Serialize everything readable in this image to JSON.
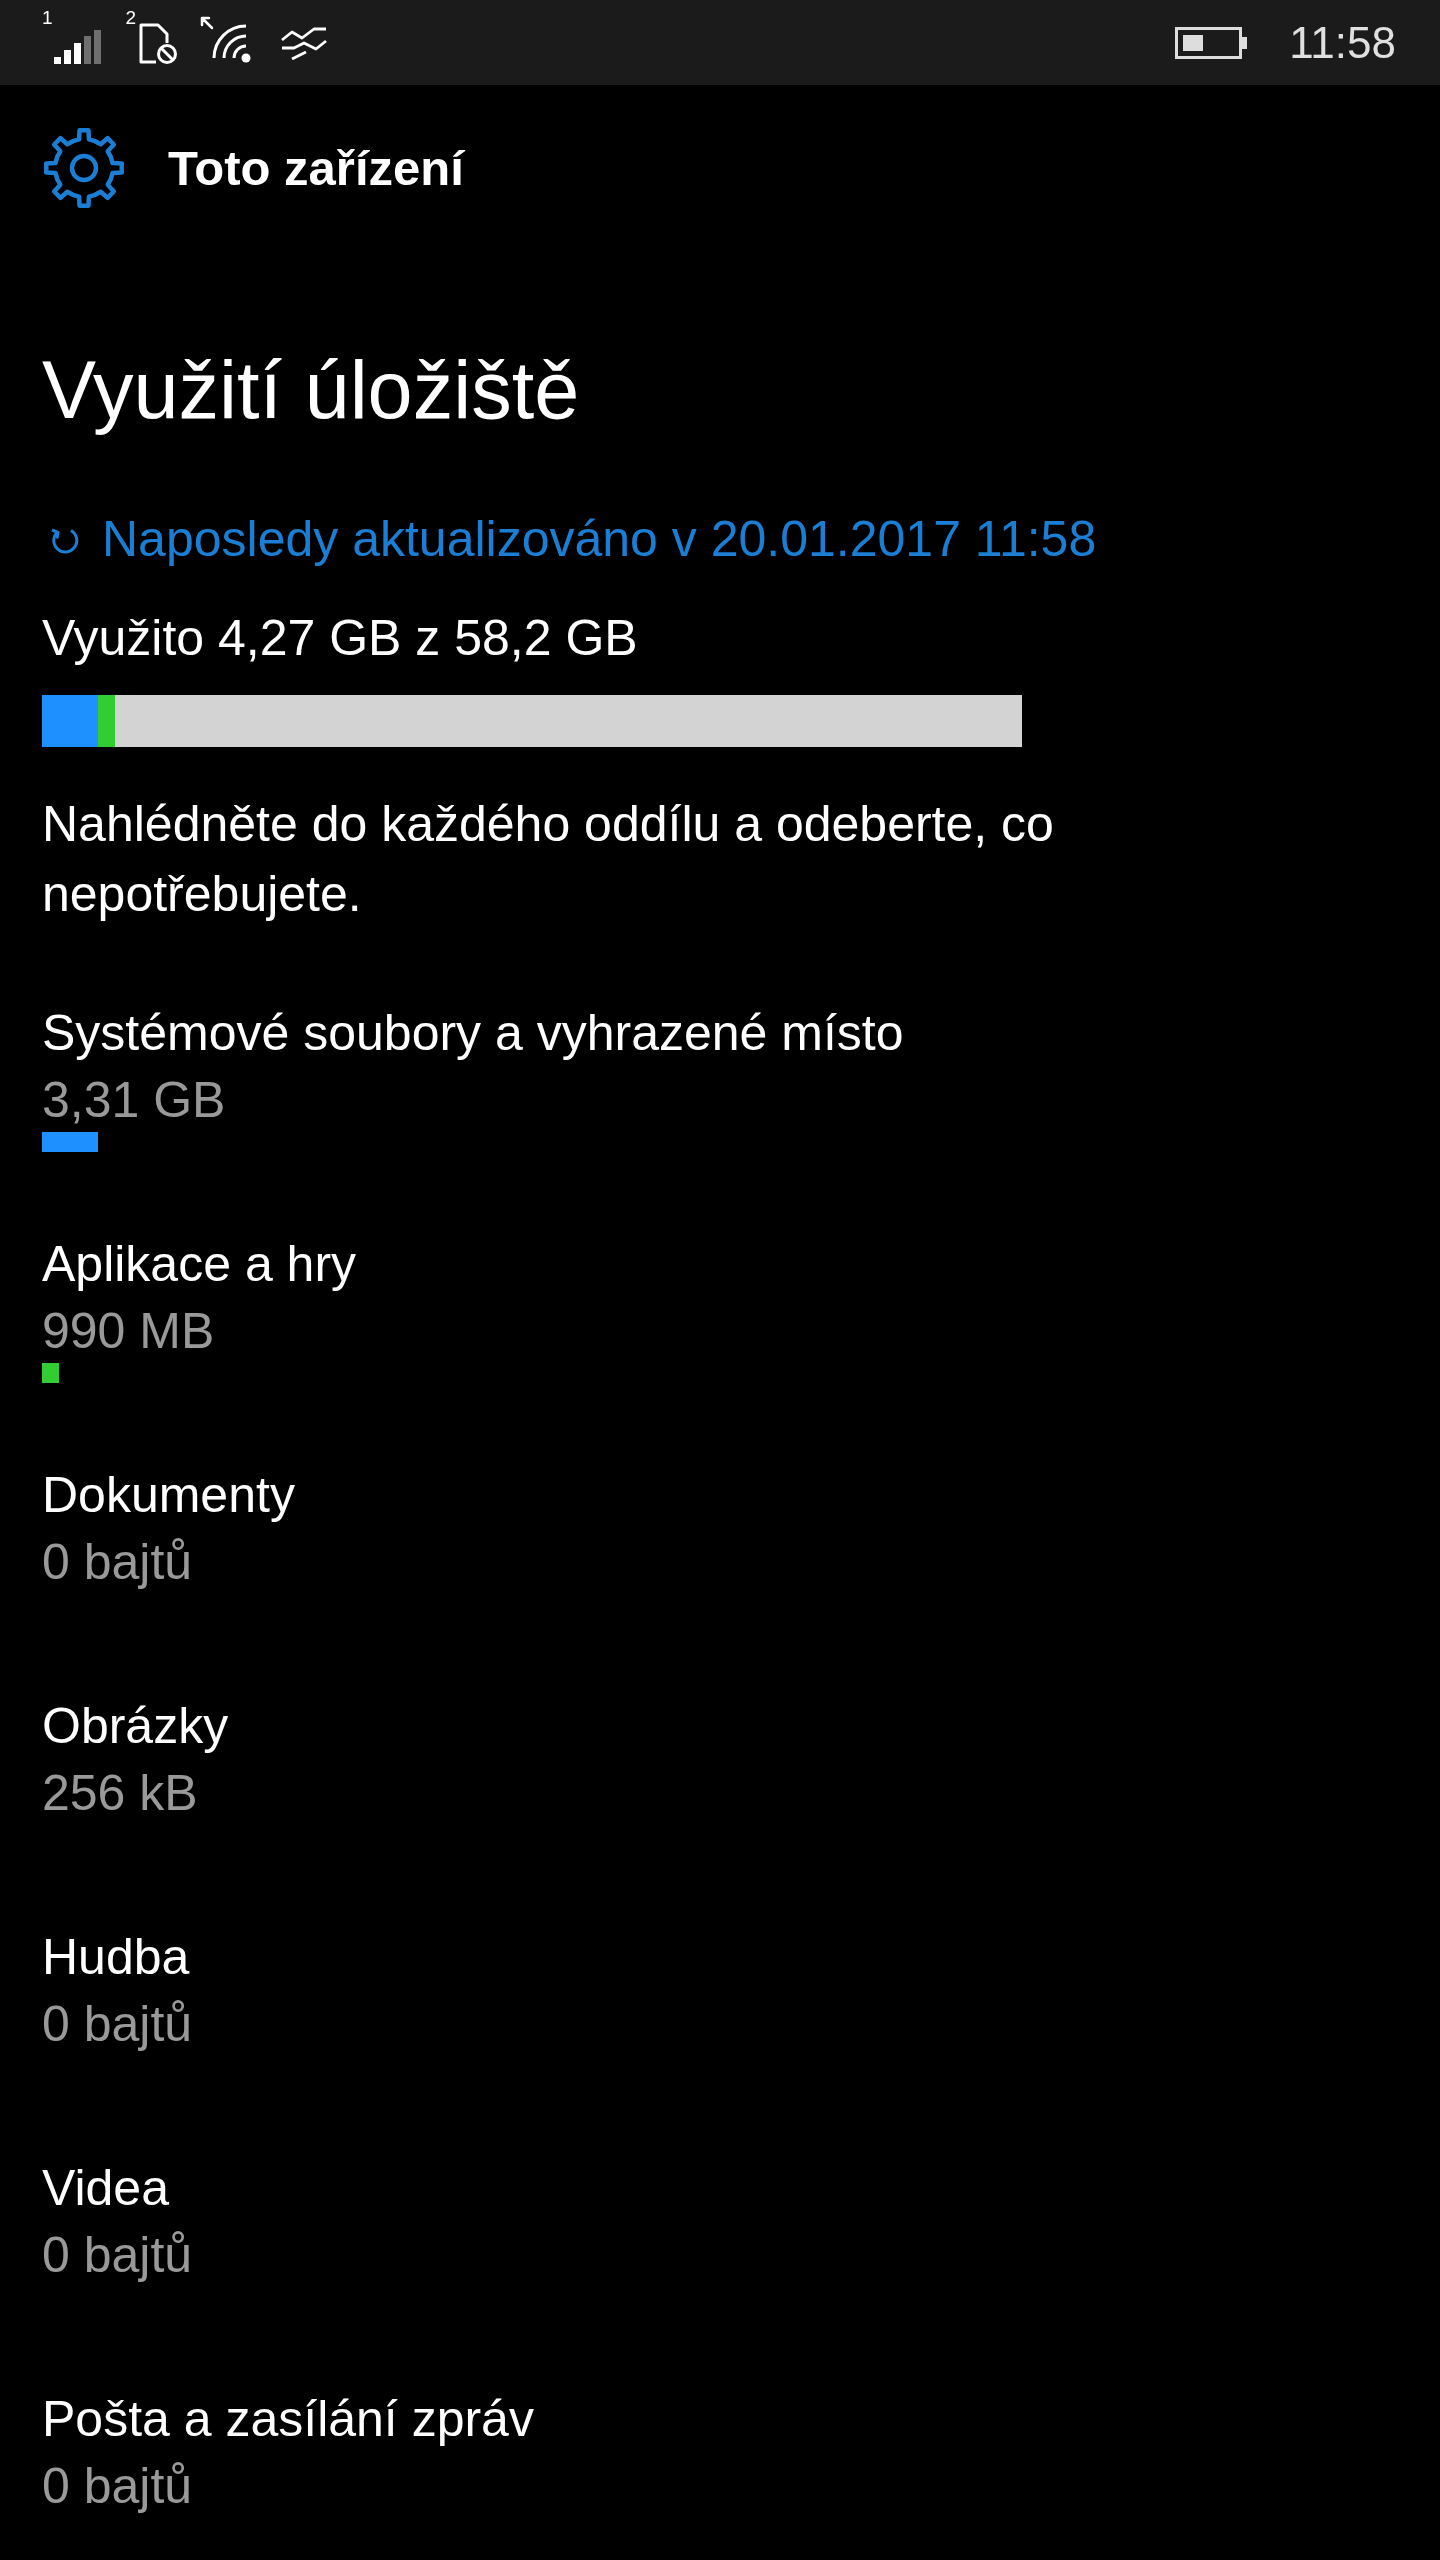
{
  "status_bar": {
    "sim_1_label": "1",
    "sim_2_label": "2",
    "time": "11:58"
  },
  "header": {
    "title": "Toto zařízení"
  },
  "page": {
    "title": "Využití úložiště",
    "refresh_link": "Naposledy aktualizováno v 20.01.2017 11:58",
    "used_summary": "Využito 4,27 GB z 58,2 GB",
    "hint": "Nahlédněte do každého oddílu a odeberte, co nepotřebujete."
  },
  "categories": [
    {
      "name": "Systémové soubory a vyhrazené místo",
      "size": "3,31 GB",
      "level": 0.057,
      "color": "#1e90ff"
    },
    {
      "name": "Aplikace a hry",
      "size": "990 MB",
      "level": 0.017,
      "color": "#32cd32"
    },
    {
      "name": "Dokumenty",
      "size": "0 bajtů"
    },
    {
      "name": "Obrázky",
      "size": "256 kB"
    },
    {
      "name": "Hudba",
      "size": "0 bajtů"
    },
    {
      "name": "Videa",
      "size": "0 bajtů"
    },
    {
      "name": "Pošta a zasílání zpráv",
      "size": "0 bajtů"
    }
  ]
}
